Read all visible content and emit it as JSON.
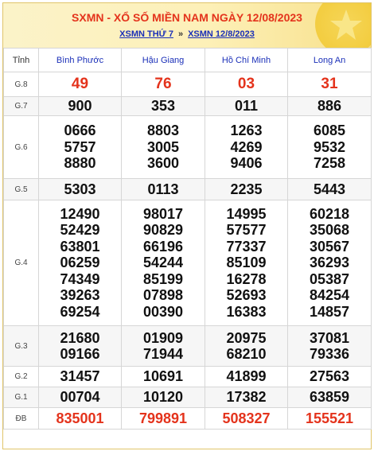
{
  "header": {
    "title": "SXMN - XỔ SỐ MIỀN NAM NGÀY 12/08/2023",
    "link1": "XSMN THỨ 7",
    "separator": "»",
    "link2": "XSMN 12/8/2023"
  },
  "table": {
    "col_label": "Tỉnh",
    "provinces": [
      "Bình Phước",
      "Hậu Giang",
      "Hồ Chí Minh",
      "Long An"
    ],
    "rows": [
      {
        "prize": "G.8",
        "values": [
          [
            "49"
          ],
          [
            "76"
          ],
          [
            "03"
          ],
          [
            "31"
          ]
        ]
      },
      {
        "prize": "G.7",
        "values": [
          [
            "900"
          ],
          [
            "353"
          ],
          [
            "011"
          ],
          [
            "886"
          ]
        ]
      },
      {
        "prize": "G.6",
        "values": [
          [
            "0666",
            "5757",
            "8880"
          ],
          [
            "8803",
            "3005",
            "3600"
          ],
          [
            "1263",
            "4269",
            "9406"
          ],
          [
            "6085",
            "9532",
            "7258"
          ]
        ]
      },
      {
        "prize": "G.5",
        "values": [
          [
            "5303"
          ],
          [
            "0113"
          ],
          [
            "2235"
          ],
          [
            "5443"
          ]
        ]
      },
      {
        "prize": "G.4",
        "values": [
          [
            "12490",
            "52429",
            "63801",
            "06259",
            "74349",
            "39263",
            "69254"
          ],
          [
            "98017",
            "90829",
            "66196",
            "54244",
            "85199",
            "07898",
            "00390"
          ],
          [
            "14995",
            "57577",
            "77337",
            "85109",
            "16278",
            "52693",
            "16383"
          ],
          [
            "60218",
            "35068",
            "30567",
            "36293",
            "05387",
            "84254",
            "14857"
          ]
        ]
      },
      {
        "prize": "G.3",
        "values": [
          [
            "21680",
            "09166"
          ],
          [
            "01909",
            "71944"
          ],
          [
            "20975",
            "68210"
          ],
          [
            "37081",
            "79336"
          ]
        ]
      },
      {
        "prize": "G.2",
        "values": [
          [
            "31457"
          ],
          [
            "10691"
          ],
          [
            "41899"
          ],
          [
            "27563"
          ]
        ]
      },
      {
        "prize": "G.1",
        "values": [
          [
            "00704"
          ],
          [
            "10120"
          ],
          [
            "17382"
          ],
          [
            "63859"
          ]
        ]
      },
      {
        "prize": "ĐB",
        "values": [
          [
            "835001"
          ],
          [
            "799891"
          ],
          [
            "508327"
          ],
          [
            "155521"
          ]
        ]
      }
    ]
  },
  "colors": {
    "title": "#e4331c",
    "links": "#1a2fb8",
    "special_prize": "#e4331c",
    "header_bg": "#fdf0b8",
    "border": "#d6d6d6"
  },
  "icons": {
    "header_decoration": "star-icon"
  }
}
